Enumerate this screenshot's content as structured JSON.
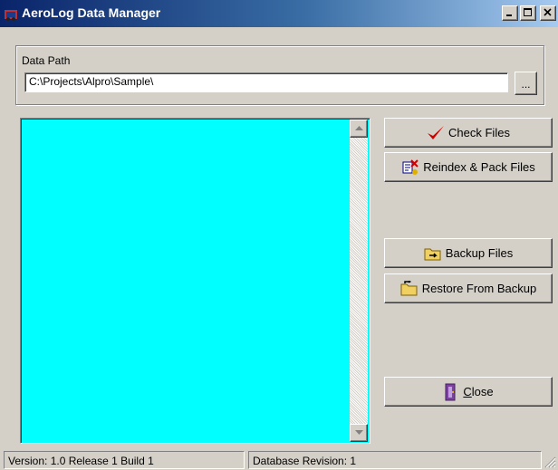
{
  "window": {
    "title": "AeroLog Data Manager",
    "controls": {
      "minimize": "_",
      "maximize": "□",
      "close": "×"
    }
  },
  "data_path": {
    "label": "Data Path",
    "value": "C:\\Projects\\Alpro\\Sample\\",
    "browse_label": "..."
  },
  "file_list": {
    "background": "#00ffff",
    "items": []
  },
  "buttons": {
    "check_files": {
      "label": "Check Files",
      "icon": "checkmark-icon"
    },
    "reindex_pack": {
      "label": "Reindex & Pack Files",
      "icon": "reindex-icon"
    },
    "backup": {
      "label": "Backup Files",
      "icon": "backup-folder-icon"
    },
    "restore": {
      "label": "Restore From Backup",
      "icon": "restore-folder-icon"
    },
    "close": {
      "label_mnemonic": "C",
      "label_rest": "lose",
      "icon": "exit-door-icon"
    }
  },
  "status": {
    "version": "Version: 1.0  Release 1  Build 1",
    "db_revision": "Database Revision: 1"
  },
  "colors": {
    "titlebar_start": "#0a246a",
    "titlebar_end": "#a6caf0",
    "face": "#d4d0c8",
    "check_red": "#cc0000"
  }
}
